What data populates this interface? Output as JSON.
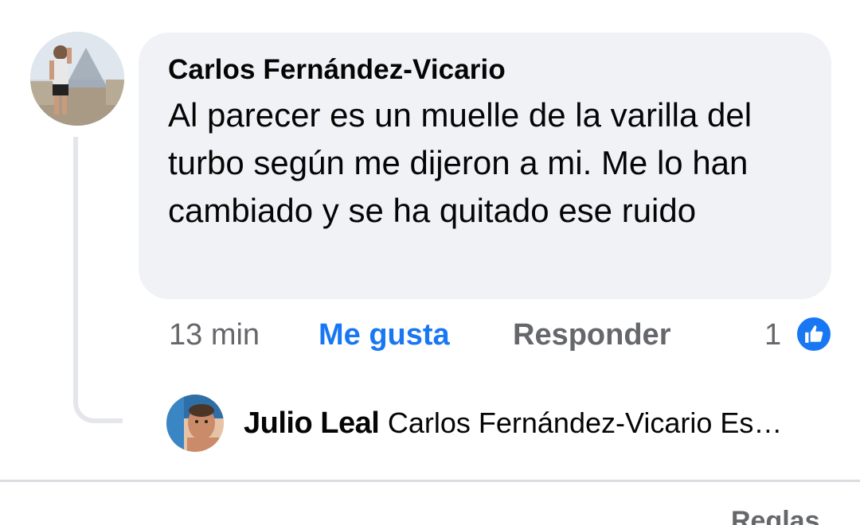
{
  "comment": {
    "author": "Carlos Fernández-Vicario",
    "text": "Al parecer es un muelle de la varilla del turbo según me dijeron a mi. Me lo han cambiado y se ha quitado ese ruido",
    "time": "13 min",
    "like_label": "Me gusta",
    "reply_label": "Responder",
    "reaction_count": "1",
    "reaction_icon": "thumbs-up-icon"
  },
  "reply": {
    "author": "Julio Leal",
    "text": "Carlos Fernández-Vicario Es…"
  },
  "footer": {
    "rules_label": "Reglas"
  },
  "colors": {
    "accent": "#1877f2",
    "bubble": "#f0f2f5",
    "secondary_text": "#65676b"
  }
}
